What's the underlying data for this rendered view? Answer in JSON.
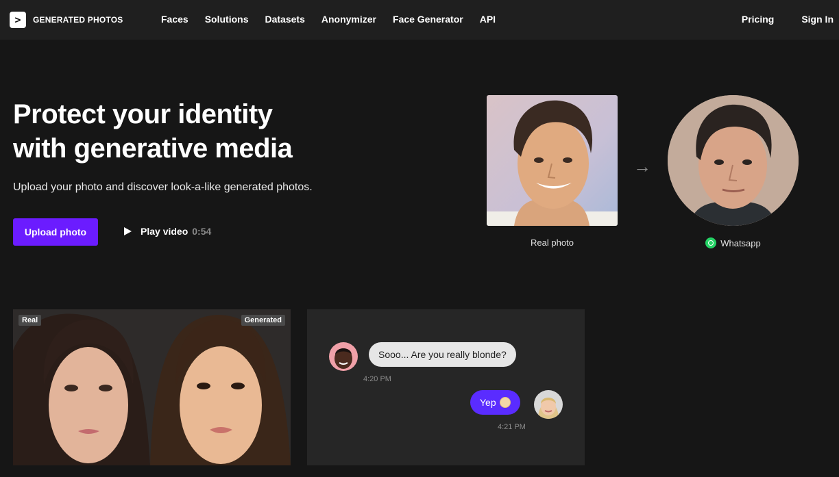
{
  "nav": {
    "logo_mark": ">",
    "logo_text": "GENERATED PHOTOS",
    "links": [
      "Faces",
      "Solutions",
      "Datasets",
      "Anonymizer",
      "Face Generator",
      "API"
    ],
    "pricing": "Pricing",
    "sign_in": "Sign In"
  },
  "hero": {
    "title_line1": "Protect your identity",
    "title_line2": "with generative media",
    "subtitle": "Upload your photo and discover look-a-like generated photos.",
    "upload_label": "Upload photo",
    "play_label": "Play video",
    "play_time": "0:54"
  },
  "comparison": {
    "real_caption": "Real photo",
    "generated_caption": "Whatsapp",
    "arrow": "→"
  },
  "faces_card": {
    "tag_real": "Real",
    "tag_generated": "Generated"
  },
  "chat": {
    "message_in": "Sooo... Are you really blonde?",
    "time_in": "4:20 PM",
    "message_out": "Yep",
    "time_out": "4:21 PM"
  },
  "colors": {
    "accent": "#6b1cff",
    "bubble_out": "#5a2cff",
    "whatsapp": "#25d366"
  }
}
